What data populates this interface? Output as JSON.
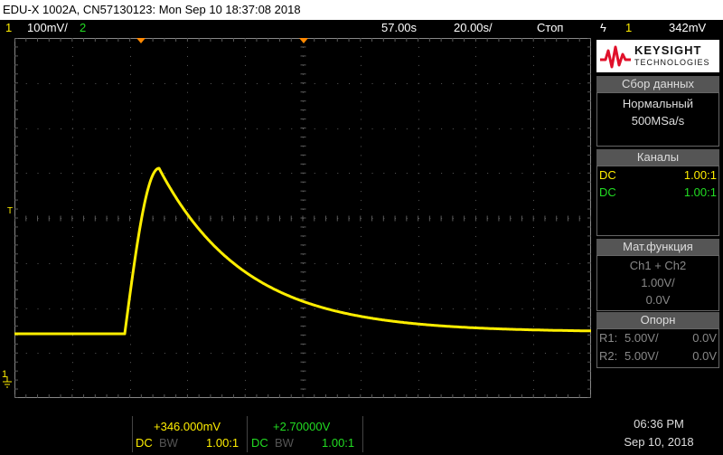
{
  "title": "EDU-X 1002A, CN57130123: Mon Sep 10 18:37:08 2018",
  "topbar": {
    "ch1_num": "1",
    "ch1_scale": "100mV/",
    "ch2_num": "2",
    "time_pos": "57.00s",
    "time_scale": "20.00s/",
    "run_state": "Стоп",
    "trig_icon": "lightning-icon",
    "trig_src": "1",
    "trig_level": "342mV"
  },
  "logo": {
    "line1": "KEYSIGHT",
    "line2": "TECHNOLOGIES"
  },
  "acquisition": {
    "header": "Сбор данных",
    "mode": "Нормальный",
    "rate": "500MSa/s"
  },
  "channels": {
    "header": "Каналы",
    "rows": [
      {
        "coupling": "DC",
        "probe": "1.00:1",
        "color": "#ffee00"
      },
      {
        "coupling": "DC",
        "probe": "1.00:1",
        "color": "#22dd22"
      }
    ]
  },
  "math": {
    "header": "Мат.функция",
    "expr": "Ch1 + Ch2",
    "scale": "1.00V/",
    "offset": "0.0V"
  },
  "reference": {
    "header": "Опорн",
    "rows": [
      {
        "name": "R1:",
        "scale": "5.00V/",
        "offset": "0.0V"
      },
      {
        "name": "R2:",
        "scale": "5.00V/",
        "offset": "0.0V"
      }
    ]
  },
  "bottom": {
    "ch1": {
      "offset": "+346.000mV",
      "coupling": "DC",
      "bw": "BW",
      "probe": "1.00:1"
    },
    "ch2": {
      "offset": "+2.70000V",
      "coupling": "DC",
      "bw": "BW",
      "probe": "1.00:1"
    }
  },
  "clock": {
    "time": "06:36 PM",
    "date": "Sep 10, 2018"
  },
  "markers": {
    "trigger": "T",
    "ch1": "1",
    "ground": "ground-icon"
  },
  "colors": {
    "ch1": "#ffee00",
    "ch2": "#22dd22",
    "trigger_marker": "#ff8800",
    "grid": "#5a5a5a"
  }
}
